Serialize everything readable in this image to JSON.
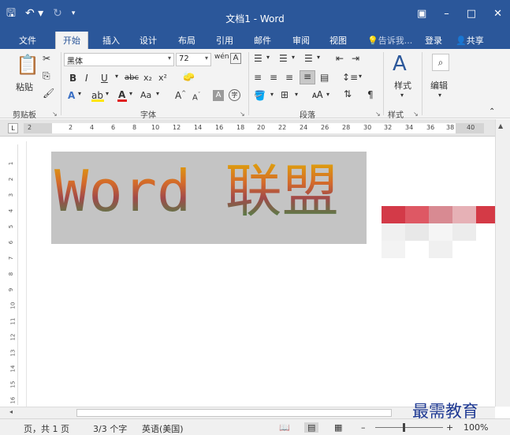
{
  "titlebar": {
    "title": "文档1 - Word",
    "qat": {
      "save_icon": "save-icon",
      "undo_icon": "undo-icon",
      "redo_icon": "redo-icon"
    },
    "controls": {
      "ribbon_display": "ribbon-display-icon",
      "minimize": "minimize-icon",
      "maximize": "maximize-icon",
      "close": "close-icon"
    }
  },
  "tabs": [
    {
      "label": "文件"
    },
    {
      "label": "开始"
    },
    {
      "label": "插入"
    },
    {
      "label": "设计"
    },
    {
      "label": "布局"
    },
    {
      "label": "引用"
    },
    {
      "label": "邮件"
    },
    {
      "label": "审阅"
    },
    {
      "label": "视图"
    }
  ],
  "tell_me": "告诉我...",
  "login": "登录",
  "share": "共享",
  "ribbon": {
    "clipboard": {
      "paste_label": "粘贴",
      "group_label": "剪贴板"
    },
    "font": {
      "font_name": "黑体",
      "font_size": "72",
      "phonetic": "wén",
      "group_label": "字体",
      "bold": "B",
      "italic": "I",
      "underline": "U",
      "strike": "abc",
      "subscript": "x₂",
      "superscript": "x²",
      "font_color_letter": "A",
      "change_case": "Aa",
      "grow_font": "A",
      "shrink_font": "A",
      "char_shading": "A",
      "enclose": "字"
    },
    "paragraph": {
      "group_label": "段落"
    },
    "styles": {
      "button_label": "样式",
      "group_label": "样式"
    },
    "editing": {
      "button_label": "编辑"
    }
  },
  "ruler": {
    "ticks": [
      "2",
      "2",
      "4",
      "6",
      "8",
      "10",
      "12",
      "14",
      "16",
      "18",
      "20",
      "22",
      "24",
      "26",
      "28",
      "30",
      "32",
      "34",
      "36",
      "38",
      "40"
    ],
    "vticks": [
      "1",
      "2",
      "3",
      "4",
      "5",
      "6",
      "7",
      "8",
      "9",
      "10",
      "11",
      "12",
      "13",
      "14",
      "15",
      "16"
    ]
  },
  "document": {
    "text": "Word 联盟"
  },
  "status": {
    "page": "页，共 1 页",
    "words": "3/3 个字",
    "language": "英语(美国)",
    "zoom": "100%"
  },
  "watermark": "最需教育"
}
